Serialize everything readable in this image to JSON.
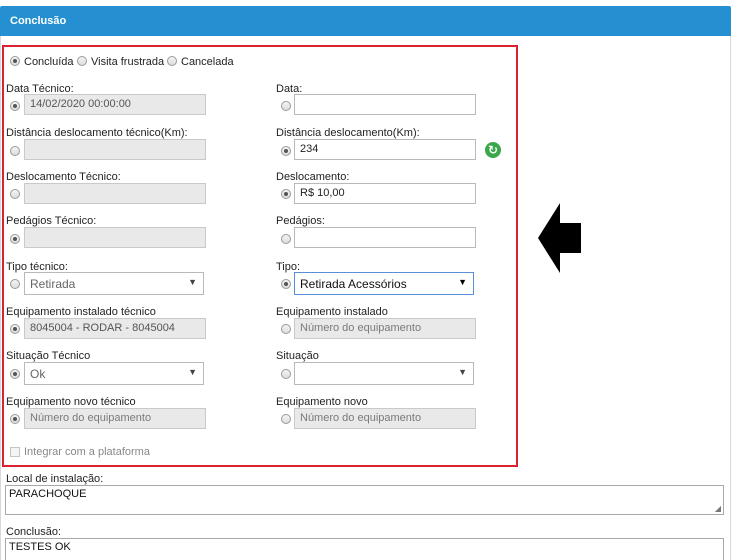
{
  "panel": {
    "title": "Conclusão"
  },
  "status_options": {
    "concluida": "Concluída",
    "visita_frustrada": "Visita frustrada",
    "cancelada": "Cancelada"
  },
  "left": {
    "data_tecnico": {
      "label": "Data Técnico:",
      "value": "14/02/2020 00:00:00"
    },
    "distancia_tecnico": {
      "label": "Distância deslocamento técnico(Km):",
      "value": ""
    },
    "deslocamento_tecnico": {
      "label": "Deslocamento Técnico:",
      "value": ""
    },
    "pedagios_tecnico": {
      "label": "Pedágios Técnico:",
      "value": ""
    },
    "tipo_tecnico": {
      "label": "Tipo técnico:",
      "value": "Retirada"
    },
    "equip_instalado_tecnico": {
      "label": "Equipamento instalado técnico",
      "value": "8045004 - RODAR - 8045004"
    },
    "situacao_tecnico": {
      "label": "Situação Técnico",
      "value": "Ok"
    },
    "equip_novo_tecnico": {
      "label": "Equipamento novo técnico",
      "placeholder": "Número do equipamento"
    },
    "integrar": {
      "label": "Integrar com a plataforma"
    }
  },
  "right": {
    "data": {
      "label": "Data:",
      "value": ""
    },
    "distancia": {
      "label": "Distância deslocamento(Km):",
      "value": "234"
    },
    "deslocamento": {
      "label": "Deslocamento:",
      "value": "R$ 10,00"
    },
    "pedagios": {
      "label": "Pedágios:",
      "value": ""
    },
    "tipo": {
      "label": "Tipo:",
      "value": "Retirada Acessórios"
    },
    "equip_instalado": {
      "label": "Equipamento instalado",
      "placeholder": "Número do equipamento"
    },
    "situacao": {
      "label": "Situação",
      "value": ""
    },
    "equip_novo": {
      "label": "Equipamento novo",
      "placeholder": "Número do equipamento"
    }
  },
  "local_instalacao": {
    "label": "Local de instalação:",
    "value": "PARACHOQUE"
  },
  "conclusao": {
    "label": "Conclusão:",
    "value": "TESTES OK"
  },
  "colors": {
    "header": "#2490d1",
    "highlight_border": "#d9232e",
    "refresh": "#3aa84a",
    "arrow": "#000000"
  }
}
